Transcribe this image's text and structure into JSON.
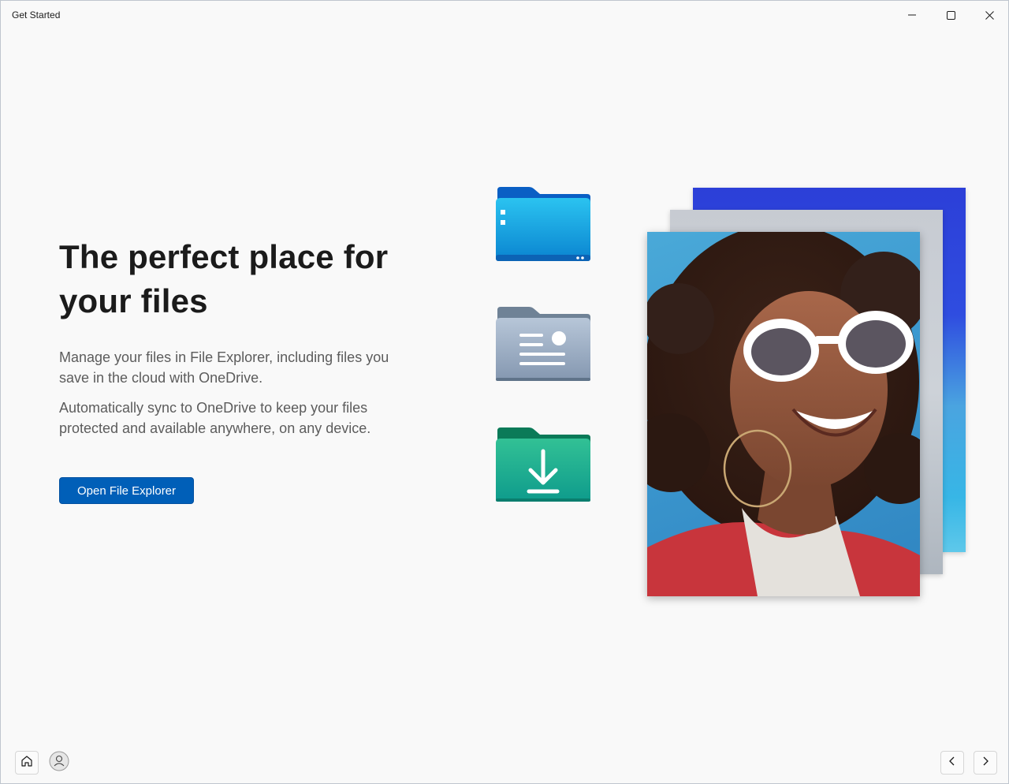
{
  "window": {
    "title": "Get Started"
  },
  "content": {
    "headline": "The perfect place for your files",
    "paragraph_1": "Manage your files in File Explorer, including files you save in the cloud with OneDrive.",
    "paragraph_2": "Automatically sync to OneDrive to keep your files protected and available anywhere, on any device.",
    "primary_button_label": "Open File Explorer"
  },
  "icons": {
    "minimize": "minimize-icon",
    "maximize": "maximize-icon",
    "close": "close-icon",
    "home": "home-icon",
    "account": "person-icon",
    "previous": "chevron-left-icon",
    "next": "chevron-right-icon",
    "folders": [
      "file-explorer-folder-icon",
      "documents-folder-icon",
      "downloads-folder-icon"
    ]
  },
  "colors": {
    "accent": "#005fb8",
    "background": "#f9f9f9",
    "heading_text": "#1b1b1b",
    "body_text": "#5c5c5c"
  }
}
